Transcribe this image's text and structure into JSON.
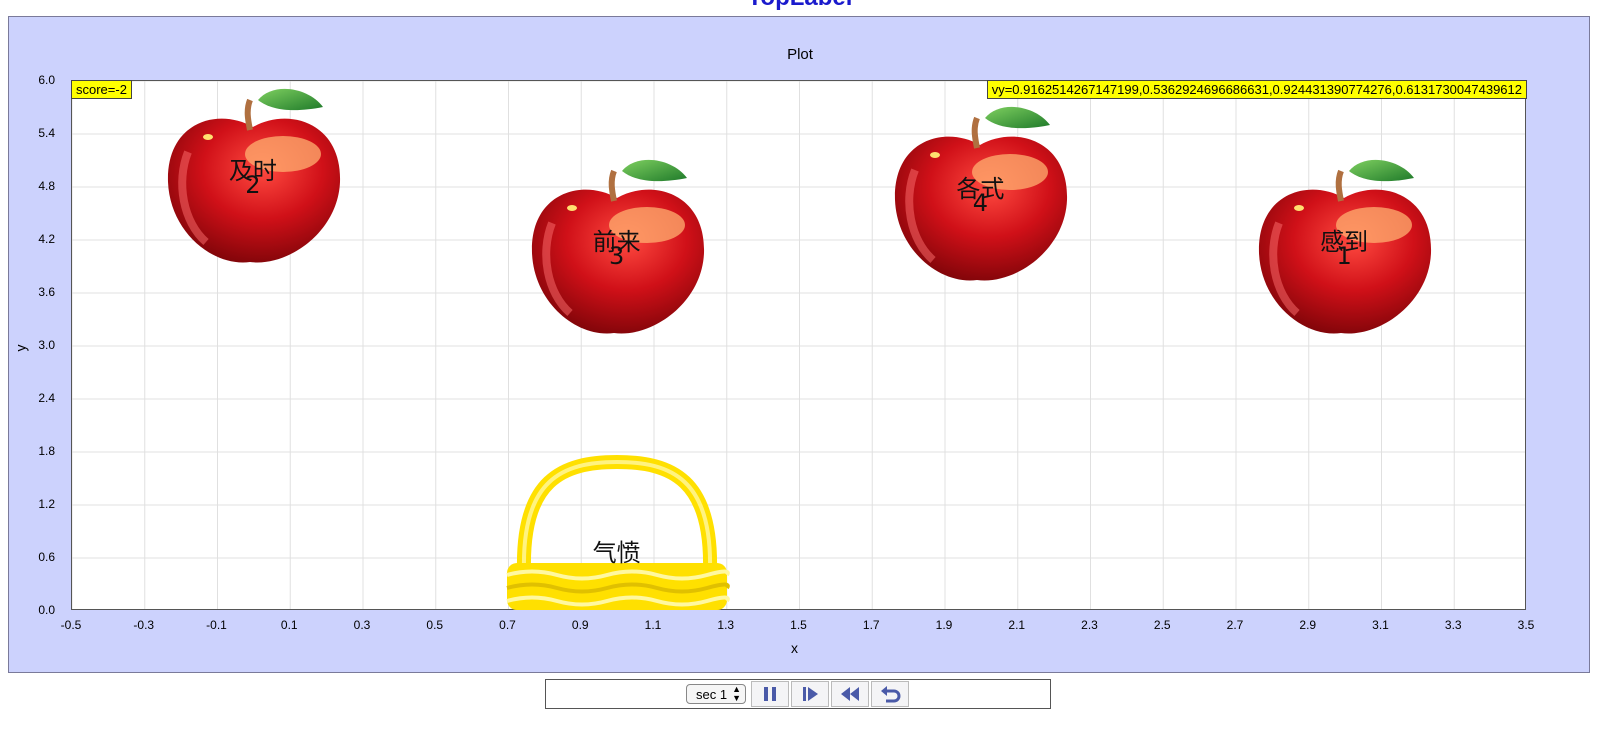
{
  "top_label": "TopLabel",
  "plot": {
    "title": "Plot",
    "xlabel": "x",
    "ylabel": "y",
    "x_ticks": [
      "-0.5",
      "-0.3",
      "-0.1",
      "0.1",
      "0.3",
      "0.5",
      "0.7",
      "0.9",
      "1.1",
      "1.3",
      "1.5",
      "1.7",
      "1.9",
      "2.1",
      "2.3",
      "2.5",
      "2.7",
      "2.9",
      "3.1",
      "3.3",
      "3.5"
    ],
    "y_ticks": [
      "0.0",
      "0.6",
      "1.2",
      "1.8",
      "2.4",
      "3.0",
      "3.6",
      "4.2",
      "4.8",
      "5.4",
      "6.0"
    ],
    "xlim": [
      -0.5,
      3.5
    ],
    "ylim": [
      0,
      6
    ],
    "grid": true
  },
  "score_label": "score=-2",
  "vy_label": "vy=0.9162514267147199,0.5362924696686631,0.924431390774276,0.6131730047439612",
  "apples": [
    {
      "word": "及时",
      "number": "2",
      "x": 0,
      "y": 4.9
    },
    {
      "word": "前来",
      "number": "3",
      "x": 1,
      "y": 4.1
    },
    {
      "word": "各式",
      "number": "4",
      "x": 2,
      "y": 4.7
    },
    {
      "word": "感到",
      "number": "1",
      "x": 3,
      "y": 4.1
    }
  ],
  "basket": {
    "word": "气愤",
    "x": 1,
    "y": 0.6
  },
  "controls": {
    "sec_value": "sec 1",
    "buttons": [
      "pause-icon",
      "step-forward-icon",
      "rewind-icon",
      "reset-icon"
    ]
  },
  "colors": {
    "frame_bg": "#ccd2fd",
    "tag_bg": "#ffff00",
    "apple_red": "#d01018",
    "basket_yellow": "#ffe000"
  }
}
